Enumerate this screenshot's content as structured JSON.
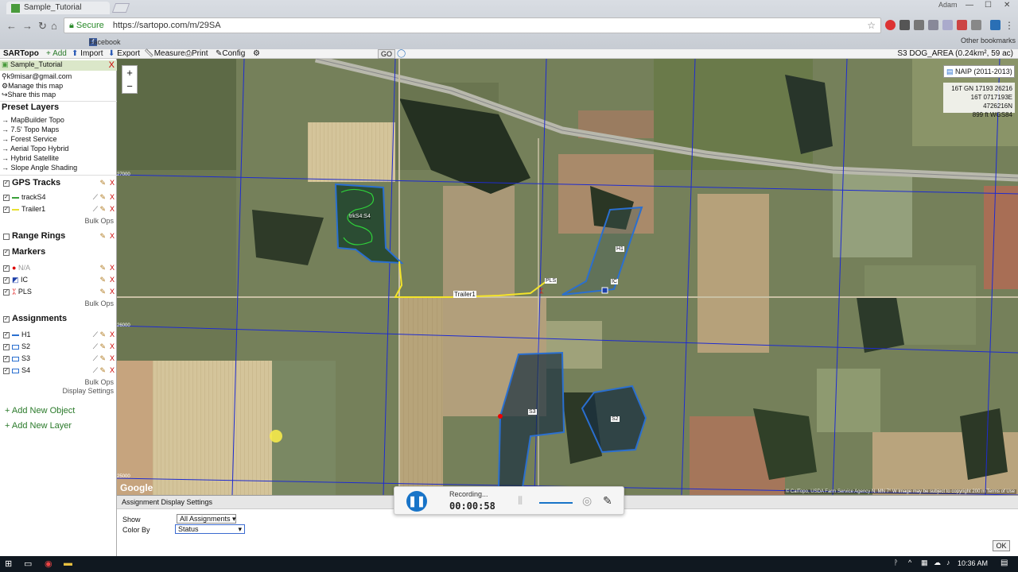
{
  "browser": {
    "tab_title": "Sample_Tutorial",
    "user": "Adam",
    "secure_label": "Secure",
    "url": "https://sartopo.com/m/29SA",
    "bookmarks": [
      "Facebook"
    ],
    "other_bookmarks": "Other bookmarks"
  },
  "toolbar": {
    "brand": "SARTopo",
    "add": "+ Add",
    "import": "Import",
    "export": "Export",
    "measure": "Measure",
    "print": "Print",
    "config": "Config",
    "go": "GO",
    "area_title": "S3 DOG_AREA (0.24km², 59 ac)"
  },
  "sidebar": {
    "map_name": "Sample_Tutorial",
    "email": "k9misar@gmail.com",
    "manage": "Manage this map",
    "share": "Share this map",
    "preset_layers_title": "Preset Layers",
    "preset_layers": [
      "MapBuilder Topo",
      "7.5' Topo Maps",
      "Forest Service",
      "Aerial Topo Hybrid",
      "Hybrid Satellite",
      "Slope Angle Shading"
    ],
    "gps_tracks_title": "GPS Tracks",
    "gps_tracks": [
      "trackS4",
      "Trailer1"
    ],
    "range_rings_title": "Range Rings",
    "markers_title": "Markers",
    "markers": [
      "N/A",
      "IC",
      "PLS"
    ],
    "assignments_title": "Assignments",
    "assignments": [
      "H1",
      "S2",
      "S3",
      "S4"
    ],
    "bulk_ops": "Bulk Ops",
    "display_settings": "Display Settings",
    "add_object": "+ Add New Object",
    "add_layer": "+ Add New Layer"
  },
  "map": {
    "naip": "NAIP (2011-2013)",
    "coord_line1": "16T GN 17193 26216",
    "coord_line2": "16T 0717193E 4726216N",
    "coord_line3": "899 ft    WGS84",
    "google": "Google",
    "attribution": "© CalTopo, USDA Farm Service Agency   N: MN 7° W   Image may be subject to copyright   200 m   Terms of Use",
    "labels": {
      "track_s4": "trkS4:S4",
      "trailer": "Trailer1",
      "pls": "PLS",
      "h1": "H1",
      "ic": "IC",
      "s3": "S3",
      "s2": "S2"
    },
    "grid_labels": [
      "27000",
      "26000",
      "25000"
    ]
  },
  "bottom_panel": {
    "title": "Assignment Display Settings",
    "show_label": "Show",
    "show_value": "All Assignments",
    "colorby_label": "Color By",
    "colorby_value": "Status",
    "ok": "OK"
  },
  "recorder": {
    "status": "Recording...",
    "time": "00:00:58"
  },
  "taskbar": {
    "time": "10:36 AM"
  }
}
